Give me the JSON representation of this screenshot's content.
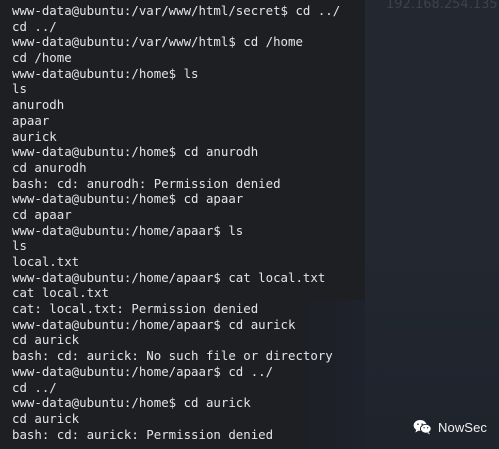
{
  "overlay": {
    "ip_text": "192.168.254.135"
  },
  "terminal": {
    "lines": [
      "www-data@ubuntu:/var/www/html/secret$ cd ../",
      "cd ../",
      "www-data@ubuntu:/var/www/html$ cd /home",
      "cd /home",
      "www-data@ubuntu:/home$ ls",
      "ls",
      "anurodh",
      "apaar",
      "aurick",
      "www-data@ubuntu:/home$ cd anurodh",
      "cd anurodh",
      "bash: cd: anurodh: Permission denied",
      "www-data@ubuntu:/home$ cd apaar",
      "cd apaar",
      "www-data@ubuntu:/home/apaar$ ls",
      "ls",
      "local.txt",
      "www-data@ubuntu:/home/apaar$ cat local.txt",
      "cat local.txt",
      "cat: local.txt: Permission denied",
      "www-data@ubuntu:/home/apaar$ cd aurick",
      "cd aurick",
      "bash: cd: aurick: No such file or directory",
      "www-data@ubuntu:/home/apaar$ cd ../",
      "cd ../",
      "www-data@ubuntu:/home$ cd aurick",
      "cd aurick",
      "bash: cd: aurick: Permission denied"
    ]
  },
  "watermark": {
    "text": "NowSec",
    "icon": "wechat-icon"
  }
}
